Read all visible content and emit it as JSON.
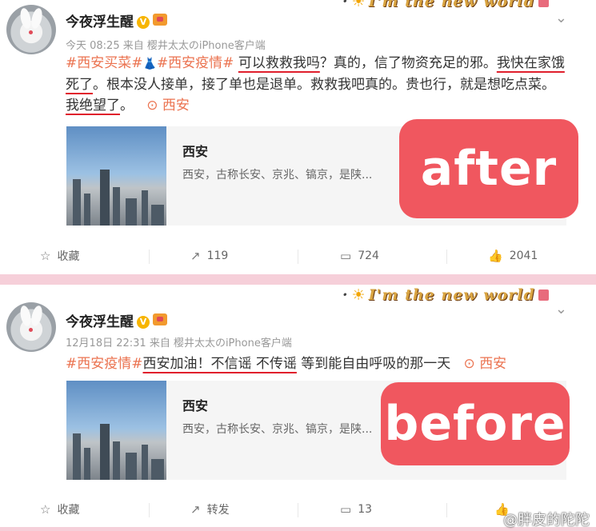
{
  "posts": [
    {
      "user_name": "今夜浮生醒",
      "meta": "今天 08:25 来自 樱井太太のiPhone客户端",
      "deco_text": "I'm the new world",
      "body": {
        "tag1": "#西安买菜#",
        "tag2": "#西安疫情#",
        "s1": " ",
        "u1": "可以救救我吗",
        "s2": "？真的，信了物资充足的邪。",
        "u2": "我快在家饿死了",
        "s3": "。根本没人接单，接了单也是退单。救救我吧真的。贵也行，就是想吃点菜。",
        "u3": "我绝望了",
        "s4": "。",
        "location": "西安"
      },
      "link_card": {
        "title": "西安",
        "desc": "西安，古称长安、京兆、镐京，是陕..."
      },
      "stamp": "after",
      "actions": {
        "favorite": "收藏",
        "repost": "119",
        "comment": "724",
        "like": "2041"
      }
    },
    {
      "user_name": "今夜浮生醒",
      "meta": "12月18日 22:31 来自 樱井太太のiPhone客户端",
      "deco_text": "I'm the new world",
      "body": {
        "tag1": "#西安疫情#",
        "u1": "西安加油！不信谣 不传谣",
        "s1": " 等到能自由呼吸的那一天",
        "location": "西安"
      },
      "link_card": {
        "title": "西安",
        "desc": "西安，古称长安、京兆、镐京，是陕..."
      },
      "stamp": "before",
      "actions": {
        "favorite": "收藏",
        "repost": "转发",
        "comment": "13"
      }
    }
  ],
  "watermark": "@胖皮的陀陀",
  "colors": {
    "tag": "#eb7350",
    "stamp": "#f0575f",
    "underline": "#e01f2c",
    "background": "#f6cfd9"
  }
}
